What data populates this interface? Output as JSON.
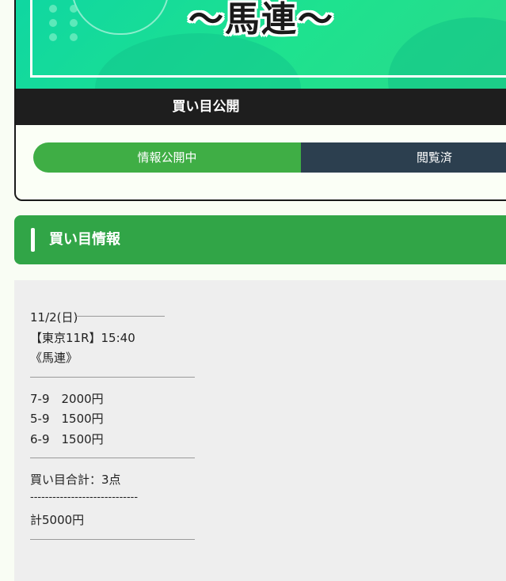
{
  "banner": {
    "title": "〜馬連〜"
  },
  "card": {
    "section_label": "買い目公開",
    "toggle": {
      "active": "情報公開中",
      "inactive": "閲覧済"
    }
  },
  "info": {
    "heading": "買い目情報",
    "date": "11/2(日)",
    "race": "【東京11R】15:40",
    "bet_type": "《馬連》",
    "bets": [
      "7-9　2000円",
      "5-9　1500円",
      "6-9　1500円"
    ],
    "count_line": "買い目合計：3点",
    "dash_line": "-----------------------------",
    "total_line": "計5000円"
  }
}
